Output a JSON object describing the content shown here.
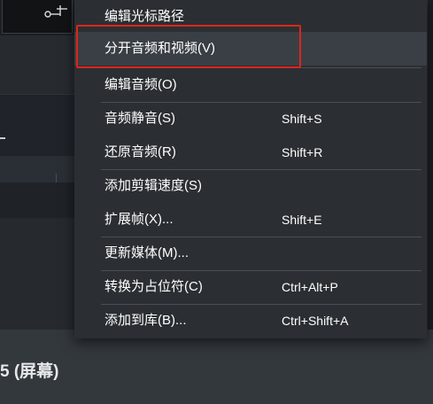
{
  "background": {
    "bottom_panel_title": "5 (屏幕)"
  },
  "menu": {
    "items": [
      {
        "label": "编辑光标路径",
        "shortcut": ""
      },
      {
        "label": "分开音频和视频(V)",
        "shortcut": ""
      },
      {
        "label": "编辑音频(O)",
        "shortcut": ""
      },
      {
        "label": "音频静音(S)",
        "shortcut": "Shift+S"
      },
      {
        "label": "还原音频(R)",
        "shortcut": "Shift+R"
      },
      {
        "label": "添加剪辑速度(S)",
        "shortcut": ""
      },
      {
        "label": "扩展帧(X)...",
        "shortcut": "Shift+E"
      },
      {
        "label": "更新媒体(M)...",
        "shortcut": ""
      },
      {
        "label": "转换为占位符(C)",
        "shortcut": "Ctrl+Alt+P"
      },
      {
        "label": "添加到库(B)...",
        "shortcut": "Ctrl+Shift+A"
      }
    ],
    "highlighted_index": 1
  },
  "colors": {
    "menu_background": "#2b2f33",
    "highlight": "#3a3f45",
    "annotation": "#e0241b",
    "text": "#ffffff"
  }
}
